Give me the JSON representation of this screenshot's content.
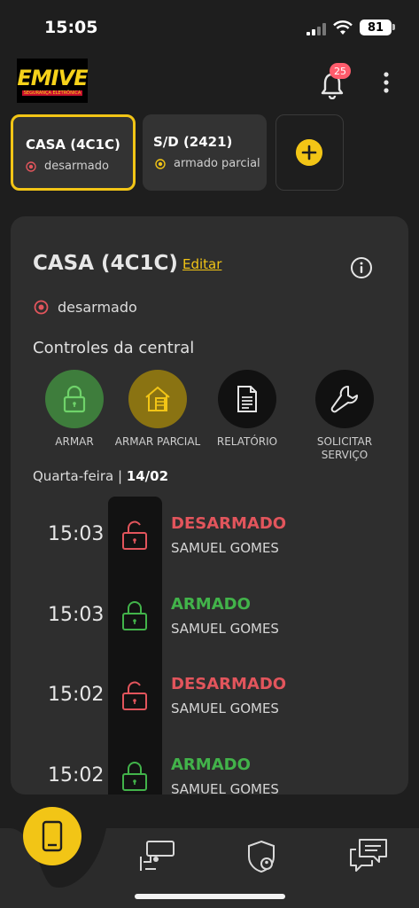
{
  "status_bar": {
    "time": "15:05",
    "battery": "81"
  },
  "header": {
    "logo_text": "EMIVE",
    "logo_subtitle": "SEGURANÇA ELETRÔNICA",
    "notifications_count": "25"
  },
  "properties": [
    {
      "name": "CASA (4C1C)",
      "status": "desarmado",
      "status_color": "#e2555c",
      "selected": true
    },
    {
      "name": "S/D (2421)",
      "status": "armado parcial",
      "status_color": "#f2c516",
      "selected": false
    }
  ],
  "panel": {
    "title": "CASA (4C1C)",
    "edit_label": "Editar",
    "status": "desarmado",
    "controls_title": "Controles da central",
    "controls": [
      {
        "label": "ARMAR",
        "icon": "padlock-icon",
        "color": "#3e7d3c"
      },
      {
        "label": "ARMAR PARCIAL",
        "icon": "house-partial-icon",
        "color": "#8a7312"
      },
      {
        "label": "RELATÓRIO",
        "icon": "document-icon",
        "color": "#111111"
      },
      {
        "label": "SOLICITAR\nSERVIÇO",
        "icon": "wrench-icon",
        "color": "#111111"
      }
    ],
    "date_day": "Quarta-feira |",
    "date_value": "14/02",
    "events": [
      {
        "time": "15:03",
        "title": "DESARMADO",
        "user": "SAMUEL GOMES",
        "type": "disarmed"
      },
      {
        "time": "15:03",
        "title": "ARMADO",
        "user": "SAMUEL GOMES",
        "type": "armed"
      },
      {
        "time": "15:02",
        "title": "DESARMADO",
        "user": "SAMUEL GOMES",
        "type": "disarmed"
      },
      {
        "time": "15:02",
        "title": "ARMADO",
        "user": "SAMUEL GOMES",
        "type": "armed"
      }
    ]
  },
  "colors": {
    "accent": "#f2c516",
    "disarmed": "#e2555c",
    "armed": "#42b34a"
  },
  "bottom_nav": [
    {
      "icon": "central-device-icon",
      "active": true
    },
    {
      "icon": "camera-icon",
      "active": false
    },
    {
      "icon": "shield-user-icon",
      "active": false
    },
    {
      "icon": "chat-icon",
      "active": false
    }
  ]
}
